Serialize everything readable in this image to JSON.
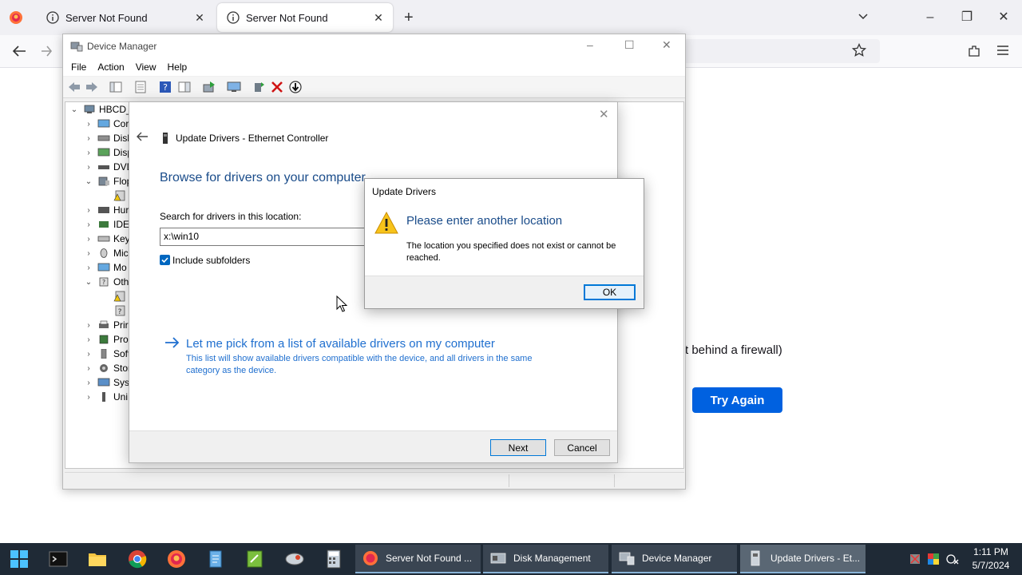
{
  "firefox": {
    "tabs": [
      {
        "title": "Server Not Found"
      },
      {
        "title": "Server Not Found"
      }
    ],
    "page": {
      "firewall_text": "t behind a firewall)",
      "try_again": "Try Again"
    }
  },
  "device_manager": {
    "title": "Device Manager",
    "menu": [
      "File",
      "Action",
      "View",
      "Help"
    ],
    "tree": {
      "root": "HBCD_",
      "items": [
        "Cor",
        "Disl",
        "Disp",
        "DVD",
        "Flop",
        "Hur",
        "IDE",
        "Key",
        "Mic",
        "Mo",
        "Oth",
        "Prir",
        "Pro",
        "Soft",
        "Stor",
        "Syst",
        "Uni"
      ]
    }
  },
  "wizard": {
    "title": "Update Drivers - Ethernet Controller",
    "heading": "Browse for drivers on your computer",
    "search_label": "Search for drivers in this location:",
    "path_value": "x:\\win10",
    "include_subfolders": "Include subfolders",
    "pick_title": "Let me pick from a list of available drivers on my computer",
    "pick_desc": "This list will show available drivers compatible with the device, and all drivers in the same category as the device.",
    "next": "Next",
    "cancel": "Cancel"
  },
  "error_dialog": {
    "title": "Update Drivers",
    "heading": "Please enter another location",
    "message": "The location you specified does not exist or cannot be reached.",
    "ok": "OK"
  },
  "taskbar": {
    "buttons": [
      {
        "label": "Server Not Found ..."
      },
      {
        "label": "Disk Management"
      },
      {
        "label": "Device Manager"
      },
      {
        "label": "Update Drivers - Et..."
      }
    ],
    "time": "1:11 PM",
    "date": "5/7/2024"
  },
  "colors": {
    "accent": "#0061e0",
    "link_blue": "#1f6fcf",
    "heading_blue": "#1a4c8a",
    "taskbar": "#1f2a36"
  }
}
